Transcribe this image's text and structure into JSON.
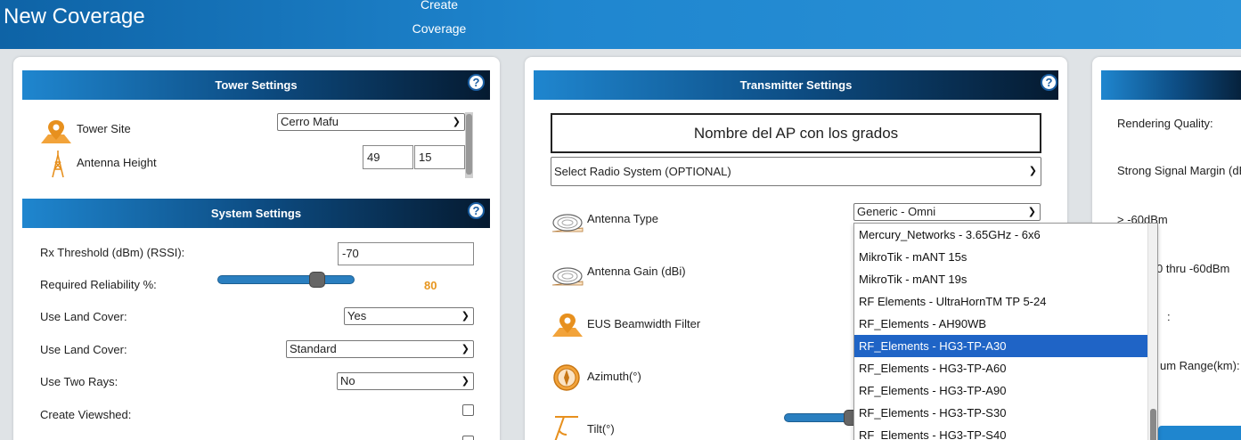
{
  "header": {
    "title": "New Coverage",
    "create_button": "Create Coverage"
  },
  "tower_settings": {
    "title": "Tower Settings",
    "tower_site_label": "Tower Site",
    "tower_site_value": "Cerro Mafu",
    "antenna_height_label": "Antenna Height",
    "antenna_height_value_1": "49",
    "antenna_height_value_2": "15"
  },
  "system_settings": {
    "title": "System Settings",
    "rx_threshold_label": "Rx Threshold (dBm) (RSSI):",
    "rx_threshold_value": "-70",
    "reliability_label": "Required Reliability %:",
    "reliability_value": "80",
    "land_cover_label_1": "Use Land Cover:",
    "land_cover_value_1": "Yes",
    "land_cover_label_2": "Use Land Cover:",
    "land_cover_value_2": "Standard",
    "two_rays_label": "Use Two Rays:",
    "two_rays_value": "No",
    "viewshed_label": "Create Viewshed:"
  },
  "transmitter_settings": {
    "title": "Transmitter Settings",
    "ap_name": "Nombre del AP con los grados",
    "radio_system_value": "Select Radio System (OPTIONAL)",
    "antenna_type_label": "Antenna Type",
    "antenna_type_value": "Generic - Omni",
    "antenna_gain_label": "Antenna Gain (dBi)",
    "beamwidth_label": "EUS Beamwidth Filter",
    "azimuth_label": "Azimuth(°)",
    "tilt_label": "Tilt(°)"
  },
  "antenna_dropdown": {
    "items": [
      "Mercury_Networks - 3.65GHz - 6x6",
      "MikroTik - mANT 15s",
      "MikroTik - mANT 19s",
      "RF Elements - UltraHornTM TP 5-24",
      "RF_Elements - AH90WB",
      "RF_Elements - HG3-TP-A30",
      "RF_Elements - HG3-TP-A60",
      "RF_Elements - HG3-TP-A90",
      "RF_Elements - HG3-TP-S30",
      "RF_Elements - HG3-TP-S40"
    ],
    "selected_index": 5
  },
  "render_settings": {
    "quality_label": "Rendering Quality:",
    "strong_margin_label": "Strong Signal Margin (dB",
    "level_1": "> -60dBm",
    "level_2": "0 thru -60dBm",
    "level_3": ":",
    "range_label": "um Range(km):"
  },
  "colors": {
    "header_blue": "#1f86cf",
    "selection_blue": "#1f64c6",
    "reliability_orange": "#e7961f"
  }
}
